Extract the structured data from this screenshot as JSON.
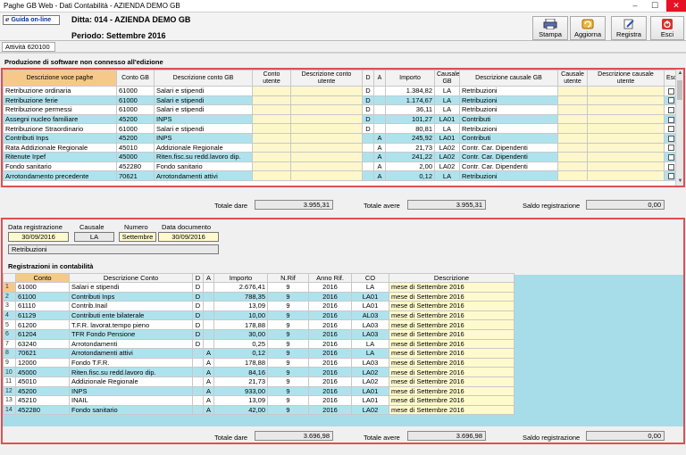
{
  "window": {
    "title": "Paghe GB Web - Dati Contabilità - AZIENDA DEMO GB",
    "min": "–",
    "max": "☐",
    "close": "✕"
  },
  "header": {
    "guida_label": "Guida on-line",
    "ditta": "Ditta: 014 - AZIENDA DEMO GB",
    "periodo": "Periodo: Settembre 2016",
    "buttons": {
      "stampa": "Stampa",
      "aggiorna": "Aggiorna",
      "registra": "Registra",
      "esci": "Esci"
    }
  },
  "attivita": "Attività 620100",
  "section_title": "Produzione di software non connesso all'edizione",
  "grid1": {
    "headers": [
      "Descrizione voce paghe",
      "Conto GB",
      "Descrizione conto GB",
      "Conto utente",
      "Descrizione conto utente",
      "D",
      "A",
      "Importo",
      "Causale GB",
      "Descrizione causale GB",
      "Causale utente",
      "Descrizione causale utente",
      "Esci"
    ],
    "rows": [
      [
        "Retribuzione ordinaria",
        "61000",
        "Salari e stipendi",
        "",
        "",
        "D",
        "",
        "1.384,82",
        "LA",
        "Retribuzioni",
        "",
        ""
      ],
      [
        "Retribuzione ferie",
        "61000",
        "Salari e stipendi",
        "",
        "",
        "D",
        "",
        "1.174,67",
        "LA",
        "Retribuzioni",
        "",
        ""
      ],
      [
        "Retribuzione permessi",
        "61000",
        "Salari e stipendi",
        "",
        "",
        "D",
        "",
        "36,11",
        "LA",
        "Retribuzioni",
        "",
        ""
      ],
      [
        "Assegni nucleo familiare",
        "45200",
        "INPS",
        "",
        "",
        "D",
        "",
        "101,27",
        "LA01",
        "Contributi",
        "",
        ""
      ],
      [
        "Retribuzione Straordinario",
        "61000",
        "Salari e stipendi",
        "",
        "",
        "D",
        "",
        "80,81",
        "LA",
        "Retribuzioni",
        "",
        ""
      ],
      [
        "Contributi Inps",
        "45200",
        "INPS",
        "",
        "",
        "",
        "A",
        "245,92",
        "LA01",
        "Contributi",
        "",
        ""
      ],
      [
        "Rata Addizionale Regionale",
        "45010",
        "Addizionale Regionale",
        "",
        "",
        "",
        "A",
        "21,73",
        "LA02",
        "Contr. Car. Dipendenti",
        "",
        ""
      ],
      [
        "Ritenute Irpef",
        "45000",
        "Riten.fisc.su redd.lavoro dip.",
        "",
        "",
        "",
        "A",
        "241,22",
        "LA02",
        "Contr. Car. Dipendenti",
        "",
        ""
      ],
      [
        "Fondo sanitario",
        "452280",
        "Fondo sanitario",
        "",
        "",
        "",
        "A",
        "2,00",
        "LA02",
        "Contr. Car. Dipendenti",
        "",
        ""
      ],
      [
        "Arrotondamento precedente",
        "70621",
        "Arrotondamenti attivi",
        "",
        "",
        "",
        "A",
        "0,12",
        "LA",
        "Retribuzioni",
        "",
        ""
      ]
    ]
  },
  "totals1": {
    "dare_label": "Totale dare",
    "dare": "3.955,31",
    "avere_label": "Totale avere",
    "avere": "3.955,31",
    "saldo_label": "Saldo registrazione",
    "saldo": "0,00"
  },
  "reg": {
    "data_label": "Data registrazione",
    "data": "30/09/2016",
    "causale_label": "Causale",
    "causale": "LA",
    "numero_label": "Numero",
    "numero": "Settembre",
    "datadoc_label": "Data documento",
    "datadoc": "30/09/2016",
    "descrizione": "Retribuzioni",
    "title": "Registrazioni in contabilità"
  },
  "grid2": {
    "headers": [
      "Conto",
      "Descrizione Conto",
      "D",
      "A",
      "Importo",
      "N.Rif",
      "Anno Rif.",
      "CO",
      "Descrizione"
    ],
    "rows": [
      [
        "1",
        "61000",
        "Salari e stipendi",
        "D",
        "",
        "2.676,41",
        "9",
        "2016",
        "LA",
        "mese di Settembre 2016"
      ],
      [
        "2",
        "61100",
        "Contributi Inps",
        "D",
        "",
        "788,35",
        "9",
        "2016",
        "LA01",
        "mese di Settembre 2016"
      ],
      [
        "3",
        "61110",
        "Contrib.Inail",
        "D",
        "",
        "13,09",
        "9",
        "2016",
        "LA01",
        "mese di Settembre 2016"
      ],
      [
        "4",
        "61129",
        "Contributi ente bilaterale",
        "D",
        "",
        "10,00",
        "9",
        "2016",
        "AL03",
        "mese di Settembre 2016"
      ],
      [
        "5",
        "61200",
        "T.F.R. lavorat.tempo pieno",
        "D",
        "",
        "178,88",
        "9",
        "2016",
        "LA03",
        "mese di Settembre 2016"
      ],
      [
        "6",
        "61204",
        "TFR Fondo Pensione",
        "D",
        "",
        "30,00",
        "9",
        "2016",
        "LA03",
        "mese di Settembre 2016"
      ],
      [
        "7",
        "63240",
        "Arrotondamenti",
        "D",
        "",
        "0,25",
        "9",
        "2016",
        "LA",
        "mese di Settembre 2016"
      ],
      [
        "8",
        "70621",
        "Arrotondamenti attivi",
        "",
        "A",
        "0,12",
        "9",
        "2016",
        "LA",
        "mese di Settembre 2016"
      ],
      [
        "9",
        "12000",
        "Fondo T.F.R.",
        "",
        "A",
        "178,88",
        "9",
        "2016",
        "LA03",
        "mese di Settembre 2016"
      ],
      [
        "10",
        "45000",
        "Riten.fisc.su redd.lavoro dip.",
        "",
        "A",
        "84,16",
        "9",
        "2016",
        "LA02",
        "mese di Settembre 2016"
      ],
      [
        "11",
        "45010",
        "Addizionale Regionale",
        "",
        "A",
        "21,73",
        "9",
        "2016",
        "LA02",
        "mese di Settembre 2016"
      ],
      [
        "12",
        "45200",
        "INPS",
        "",
        "A",
        "933,00",
        "9",
        "2016",
        "LA01",
        "mese di Settembre 2016"
      ],
      [
        "13",
        "45210",
        "INAIL",
        "",
        "A",
        "13,09",
        "9",
        "2016",
        "LA01",
        "mese di Settembre 2016"
      ],
      [
        "14",
        "452280",
        "Fondo sanitario",
        "",
        "A",
        "42,00",
        "9",
        "2016",
        "LA02",
        "mese di Settembre 2016"
      ]
    ]
  },
  "totals2": {
    "dare_label": "Totale dare",
    "dare": "3.696,98",
    "avere_label": "Totale avere",
    "avere": "3.696,98",
    "saldo_label": "Saldo registrazione",
    "saldo": "0,00"
  }
}
